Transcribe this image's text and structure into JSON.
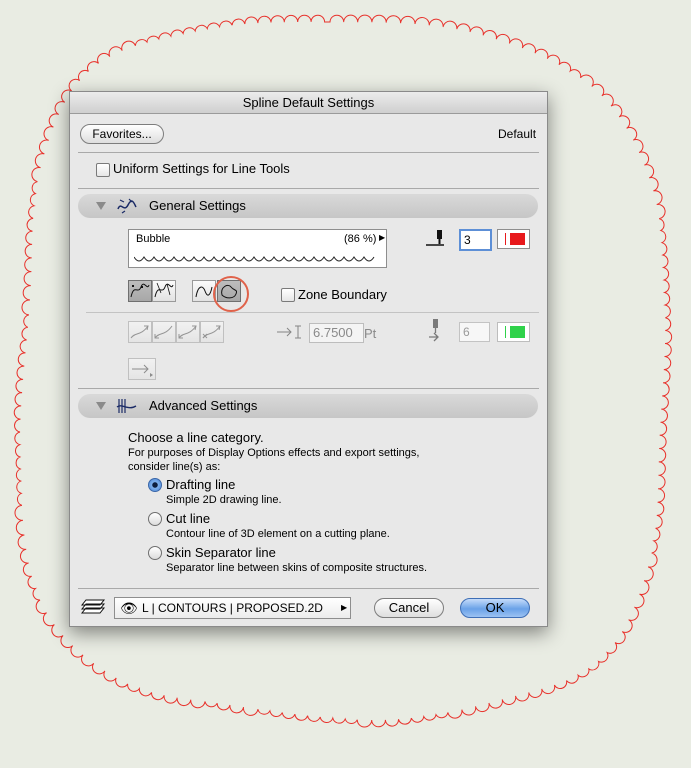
{
  "dialog": {
    "title": "Spline Default Settings",
    "favorites_label": "Favorites...",
    "default_label": "Default",
    "uniform_settings_label": "Uniform Settings for Line Tools"
  },
  "general": {
    "section_title": "General Settings",
    "line_type_name": "Bubble",
    "line_type_scale": "(86 %)",
    "pen_number": "3",
    "pen_color": "#e8191c",
    "zone_boundary_label": "Zone Boundary",
    "arrow_size": "6.7500",
    "arrow_unit": "Pt",
    "arrow_pen_number": "6",
    "arrow_pen_color": "#2fd24a"
  },
  "advanced": {
    "section_title": "Advanced Settings",
    "heading": "Choose a line category.",
    "description": "For purposes of Display Options effects and export settings, consider line(s) as:",
    "options": [
      {
        "label": "Drafting line",
        "desc": "Simple 2D drawing line.",
        "selected": true
      },
      {
        "label": "Cut line",
        "desc": "Contour line of 3D element on a cutting plane.",
        "selected": false
      },
      {
        "label": "Skin Separator line",
        "desc": "Separator line between skins of composite structures.",
        "selected": false
      }
    ]
  },
  "footer": {
    "layer_name": "L | CONTOURS | PROPOSED.2D",
    "cancel_label": "Cancel",
    "ok_label": "OK"
  },
  "colors": {
    "cloud_outline": "#e8302a",
    "highlight_circle": "#e0624a",
    "ok_button": "#6aa2e8"
  },
  "icons": [
    "eye-icon",
    "layers-icon",
    "pen-icon",
    "spline-icon",
    "arrow-icon",
    "chevron-right-icon"
  ]
}
